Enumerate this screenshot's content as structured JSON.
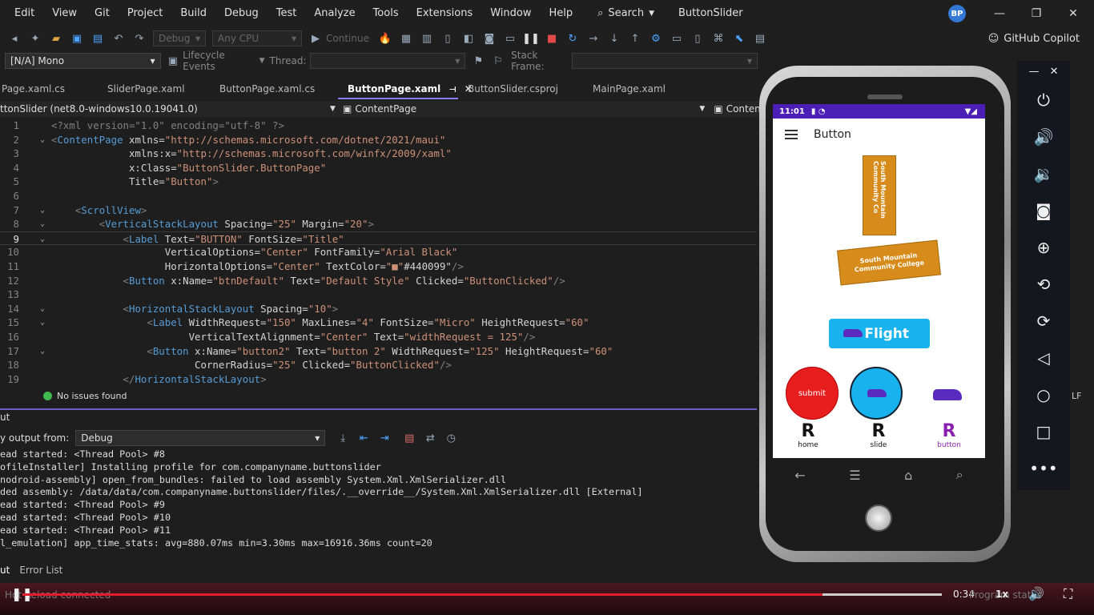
{
  "menu": [
    "Edit",
    "View",
    "Git",
    "Project",
    "Build",
    "Debug",
    "Test",
    "Analyze",
    "Tools",
    "Extensions",
    "Window",
    "Help"
  ],
  "search_label": "Search",
  "search_icon": "magnifier-icon",
  "project_title": "ButtonSlider",
  "avatar_initials": "BP",
  "toolbar": {
    "config_combo": "Debug",
    "platform_combo": "Any CPU",
    "continue_label": "Continue",
    "copilot_label": "GitHub Copilot",
    "process_combo": "[N/A] Mono",
    "lifecycle_label": "Lifecycle Events",
    "thread_label": "Thread:",
    "stackframe_label": "Stack Frame:"
  },
  "tabs": [
    {
      "label": "Page.xaml.cs",
      "active": false
    },
    {
      "label": "SliderPage.xaml",
      "active": false
    },
    {
      "label": "ButtonPage.xaml.cs",
      "active": false
    },
    {
      "label": "ButtonPage.xaml",
      "active": true
    },
    {
      "label": "ButtonSlider.csproj",
      "active": false
    },
    {
      "label": "MainPage.xaml",
      "active": false
    }
  ],
  "navbar": {
    "target": "ttonSlider (net8.0-windows10.0.19041.0)",
    "scope": "ContentPage",
    "member": "Conten"
  },
  "editor": {
    "current_line": 9,
    "lines": [
      {
        "n": "1",
        "fold": "",
        "text": "<?xml version=\"1.0\" encoding=\"utf-8\" ?>",
        "kind": "pi"
      },
      {
        "n": "2",
        "fold": "v",
        "text": "<ContentPage xmlns=\"http://schemas.microsoft.com/dotnet/2021/maui\"",
        "kind": "code"
      },
      {
        "n": "3",
        "fold": "",
        "text": "             xmlns:x=\"http://schemas.microsoft.com/winfx/2009/xaml\"",
        "kind": "code"
      },
      {
        "n": "4",
        "fold": "",
        "text": "             x:Class=\"ButtonSlider.ButtonPage\"",
        "kind": "code"
      },
      {
        "n": "5",
        "fold": "",
        "text": "             Title=\"Button\">",
        "kind": "code"
      },
      {
        "n": "6",
        "fold": "",
        "text": "",
        "kind": "code"
      },
      {
        "n": "7",
        "fold": "v",
        "text": "    <ScrollView>",
        "kind": "code"
      },
      {
        "n": "8",
        "fold": "v",
        "text": "        <VerticalStackLayout Spacing=\"25\" Margin=\"20\">",
        "kind": "code"
      },
      {
        "n": "9",
        "fold": "v",
        "text": "            <Label Text=\"BUTTON\" FontSize=\"Title\"",
        "kind": "code"
      },
      {
        "n": "10",
        "fold": "",
        "text": "                   VerticalOptions=\"Center\" FontFamily=\"Arial Black\"",
        "kind": "code"
      },
      {
        "n": "11",
        "fold": "",
        "text": "                   HorizontalOptions=\"Center\" TextColor=\"■\"#440099\"/>",
        "kind": "code"
      },
      {
        "n": "12",
        "fold": "",
        "text": "            <Button x:Name=\"btnDefault\" Text=\"Default Style\" Clicked=\"ButtonClicked\"/>",
        "kind": "code"
      },
      {
        "n": "13",
        "fold": "",
        "text": "",
        "kind": "code"
      },
      {
        "n": "14",
        "fold": "v",
        "text": "            <HorizontalStackLayout Spacing=\"10\">",
        "kind": "code"
      },
      {
        "n": "15",
        "fold": "v",
        "text": "                <Label WidthRequest=\"150\" MaxLines=\"4\" FontSize=\"Micro\" HeightRequest=\"60\"",
        "kind": "code"
      },
      {
        "n": "16",
        "fold": "",
        "text": "                       VerticalTextAlignment=\"Center\" Text=\"widthRequest = 125\"/>",
        "kind": "code"
      },
      {
        "n": "17",
        "fold": "v",
        "text": "                <Button x:Name=\"button2\" Text=\"button 2\" WidthRequest=\"125\" HeightRequest=\"60\"",
        "kind": "code"
      },
      {
        "n": "18",
        "fold": "",
        "text": "                        CornerRadius=\"25\" Clicked=\"ButtonClicked\"/>",
        "kind": "code"
      },
      {
        "n": "19",
        "fold": "",
        "text": "            </HorizontalStackLayout>",
        "kind": "code"
      }
    ]
  },
  "issues_label": "No issues found",
  "output": {
    "title": "ut",
    "show_from_label": "y output from:",
    "source": "Debug",
    "lines": [
      "ead started: <Thread Pool> #8",
      "ofileInstaller] Installing profile for com.companyname.buttonslider",
      "nodroid-assembly] open_from_bundles: failed to load assembly System.Xml.XmlSerializer.dll",
      "ded assembly: /data/data/com.companyname.buttonslider/files/.__override__/System.Xml.XmlSerializer.dll [External]",
      "ead started: <Thread Pool> #9",
      "ead started: <Thread Pool> #10",
      "ead started: <Thread Pool> #11",
      "l_emulation] app_time_stats: avg=880.07ms min=3.30ms max=16916.36ms count=20"
    ]
  },
  "bottom_tabs": [
    "ut",
    "Error List"
  ],
  "video": {
    "time": "0:34",
    "speed": "1x",
    "progress_fraction": 0.87,
    "faint_status": "Hot Reload connected",
    "faint_right": "Program status"
  },
  "phone": {
    "time": "11:01",
    "page_title": "Button",
    "sign_vertical": "South Mountain Community Co",
    "sign_rotated": "South Mountain Community College",
    "flight_label": "Flight",
    "submit_label": "submit",
    "tabs": [
      {
        "letter": "R",
        "label": "home",
        "active": false
      },
      {
        "letter": "R",
        "label": "slide",
        "active": false
      },
      {
        "letter": "R",
        "label": "button",
        "active": true
      }
    ],
    "accent": "#4b1fb6",
    "flight_color": "#18b3ef",
    "submit_color": "#e81e1e",
    "active_tab_color": "#8b1fb0"
  },
  "emulator_toolbar": [
    "power-icon",
    "volume-up-icon",
    "volume-down-icon",
    "camera-icon",
    "zoom-icon",
    "rotate-left-icon",
    "rotate-right-icon",
    "back-icon",
    "home-icon",
    "overview-icon",
    "more-icon"
  ],
  "right_edge": {
    "lf_label": "LF"
  }
}
